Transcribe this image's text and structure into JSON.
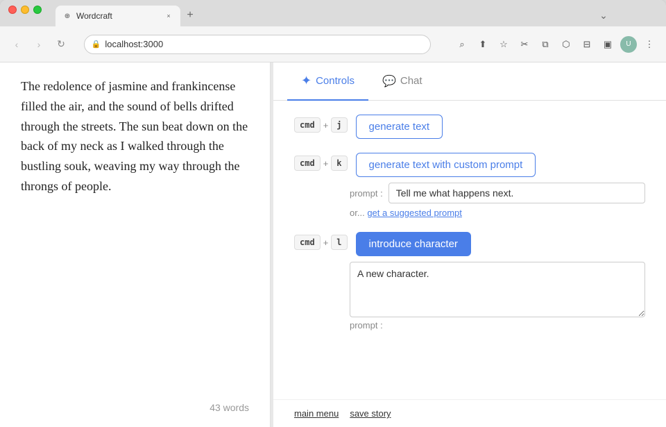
{
  "browser": {
    "tab_label": "Wordcraft",
    "tab_close": "×",
    "tab_new": "+",
    "url": "localhost:3000",
    "nav_back": "‹",
    "nav_forward": "›",
    "nav_refresh": "↻",
    "traffic_lights": [
      "red",
      "yellow",
      "green"
    ]
  },
  "toolbar_icons": {
    "zoom": "⌕",
    "share": "↑",
    "bookmark": "★",
    "cut": "✂",
    "copy": "⧉",
    "extensions": "🧩",
    "sidebar": "⊟",
    "window": "⬜",
    "menu": "⋮"
  },
  "editor": {
    "text": "The redolence of jasmine and frankincense filled the air, and the sound of bells drifted through the streets. The sun beat down on the back of my neck as I walked through the bustling souk, weaving my way through the throngs of people.",
    "word_count": "43 words"
  },
  "controls": {
    "tab_controls_label": "Controls",
    "tab_chat_label": "Chat",
    "shortcuts": [
      {
        "key1": "cmd",
        "plus": "+",
        "key2": "j",
        "button_label": "generate text",
        "filled": false
      },
      {
        "key1": "cmd",
        "plus": "+",
        "key2": "k",
        "button_label": "generate text with custom prompt",
        "filled": false
      },
      {
        "key1": "cmd",
        "plus": "+",
        "key2": "l",
        "button_label": "introduce character",
        "filled": true
      }
    ],
    "prompt_label": "prompt :",
    "prompt_value": "Tell me what happens next.",
    "suggest_prefix": "or...",
    "suggest_link": "get a suggested prompt",
    "character_prompt_value": "A new character.",
    "bottom_links": [
      "main menu",
      "save story"
    ]
  }
}
